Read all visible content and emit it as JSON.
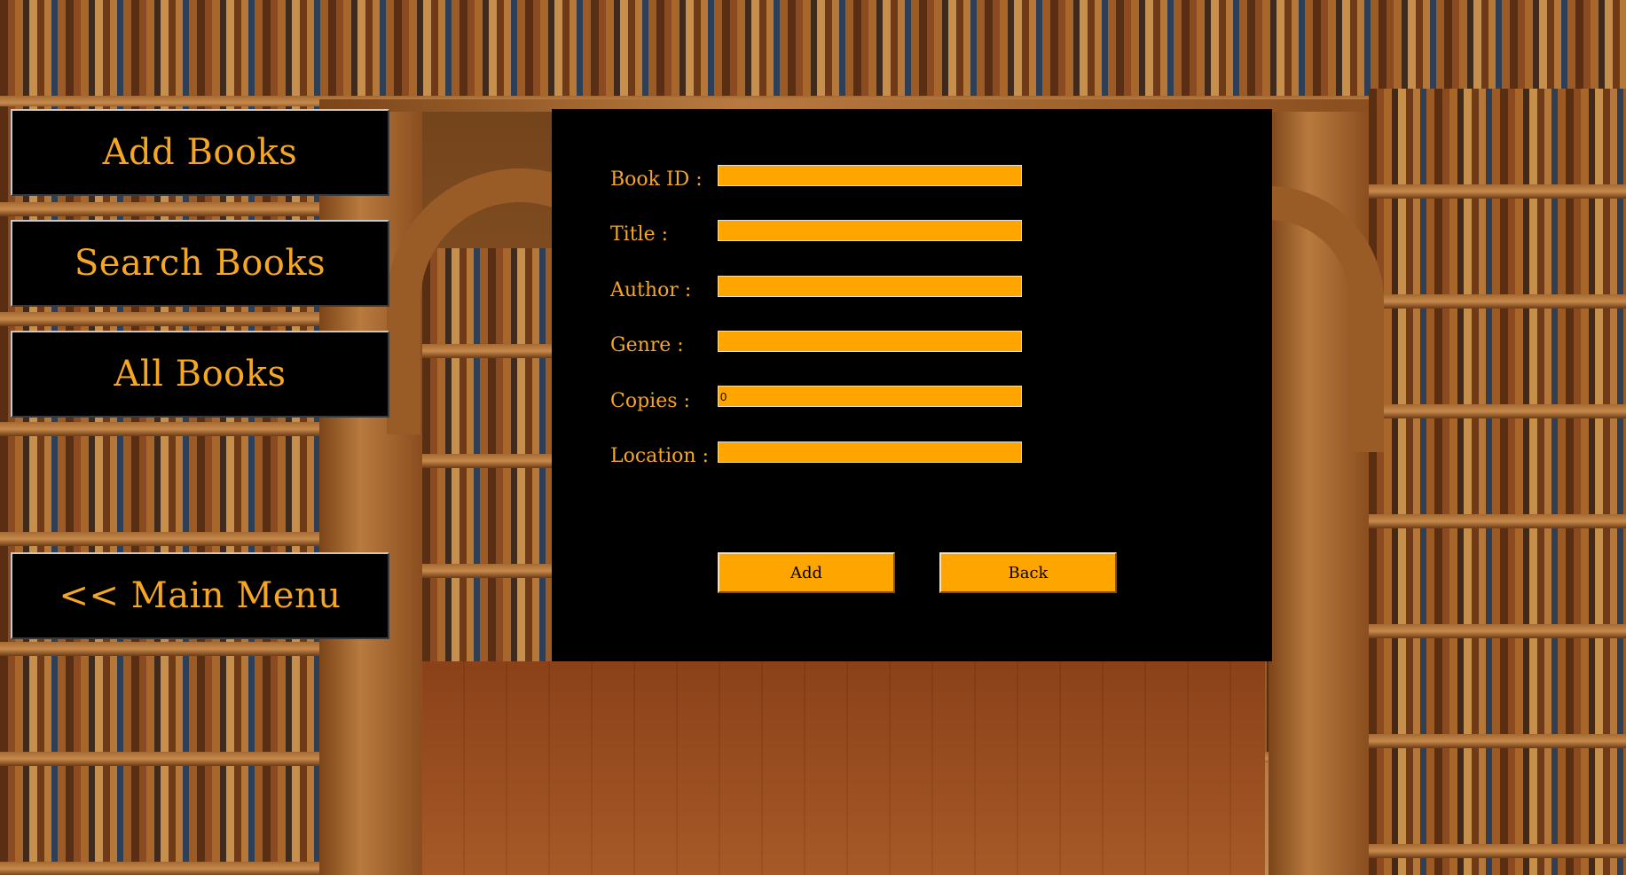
{
  "menu": {
    "add_books": "Add Books",
    "search_books": "Search Books",
    "all_books": "All Books",
    "main_menu": "<< Main Menu"
  },
  "form": {
    "fields": [
      {
        "label": "Book ID :",
        "value": ""
      },
      {
        "label": "Title :",
        "value": ""
      },
      {
        "label": "Author :",
        "value": ""
      },
      {
        "label": "Genre :",
        "value": ""
      },
      {
        "label": "Copies :",
        "value": "0"
      },
      {
        "label": "Location :",
        "value": ""
      }
    ],
    "add_label": "Add",
    "back_label": "Back"
  },
  "colors": {
    "accent": "#f5a623",
    "input_bg": "#ffa500",
    "panel_bg": "#000000"
  }
}
